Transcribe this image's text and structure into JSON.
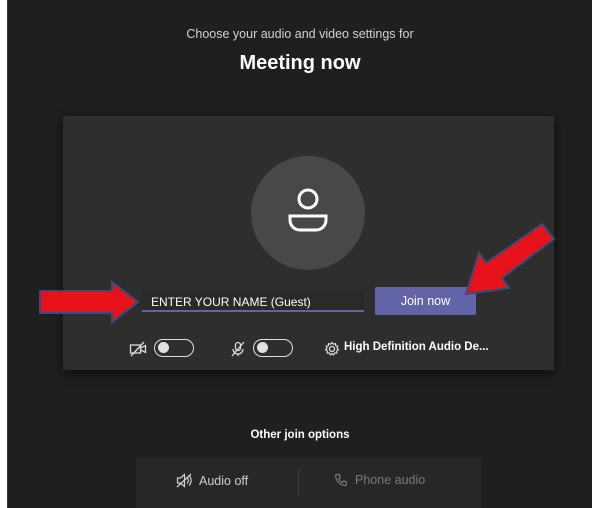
{
  "header": {
    "subtitle": "Choose your audio and video settings for",
    "title": "Meeting now"
  },
  "prejoin": {
    "name_input_value": "ENTER YOUR NAME (Guest)",
    "join_button_label": "Join now",
    "camera_toggle_state": "off",
    "mic_toggle_state": "off",
    "audio_device_label": "High Definition Audio De..."
  },
  "other_join": {
    "title": "Other join options",
    "audio_off_label": "Audio off",
    "phone_audio_label": "Phone audio"
  },
  "annotations": {
    "arrow_color": "#e8131a",
    "arrow_outline": "#3b4a7a"
  },
  "colors": {
    "background": "#1f1f1f",
    "card": "#2e2e2e",
    "accent": "#6264a7"
  }
}
